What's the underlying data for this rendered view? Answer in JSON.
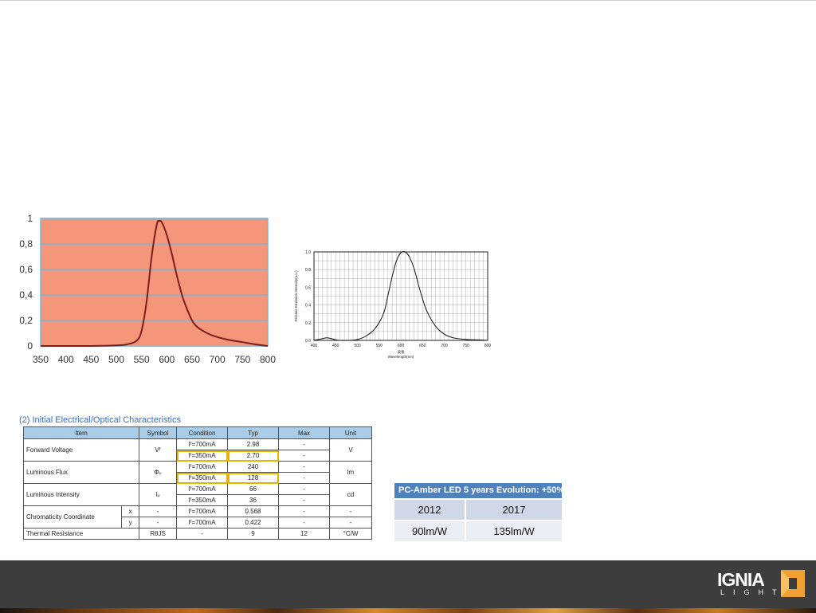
{
  "chart_data": [
    {
      "type": "line",
      "x": [
        350,
        400,
        450,
        500,
        520,
        540,
        550,
        560,
        570,
        580,
        585,
        590,
        600,
        610,
        620,
        630,
        640,
        650,
        660,
        680,
        700,
        720,
        750,
        780,
        800
      ],
      "series": [
        {
          "values": [
            0,
            0,
            0,
            0.005,
            0.012,
            0.04,
            0.12,
            0.35,
            0.7,
            0.95,
            0.98,
            0.97,
            0.87,
            0.72,
            0.55,
            0.4,
            0.29,
            0.2,
            0.15,
            0.1,
            0.07,
            0.05,
            0.03,
            0.01,
            0
          ]
        }
      ],
      "xticks": [
        "350",
        "400",
        "450",
        "500",
        "550",
        "600",
        "650",
        "700",
        "750",
        "800"
      ],
      "yticks": [
        "0",
        "0,2",
        "0,4",
        "0,6",
        "0,8",
        "1"
      ],
      "xlim": [
        350,
        800
      ],
      "ylim": [
        0,
        1
      ],
      "grid": true,
      "colors": {
        "plot_bg": "#f4967a",
        "line": "#7a1e1e",
        "grid": "#7eb6d8",
        "frame": "#7eb6d8"
      }
    },
    {
      "type": "line",
      "x": [
        400,
        410,
        420,
        430,
        440,
        450,
        460,
        480,
        500,
        520,
        540,
        560,
        570,
        580,
        590,
        600,
        610,
        620,
        630,
        640,
        650,
        660,
        680,
        700,
        720,
        750,
        780,
        800
      ],
      "series": [
        {
          "values": [
            0,
            0.01,
            0.02,
            0.03,
            0.02,
            0.005,
            0,
            0,
            0.01,
            0.05,
            0.13,
            0.3,
            0.5,
            0.72,
            0.9,
            0.99,
            1.0,
            0.94,
            0.82,
            0.64,
            0.47,
            0.33,
            0.16,
            0.07,
            0.03,
            0.01,
            0.005,
            0
          ]
        }
      ],
      "xticks": [
        "400",
        "450",
        "500",
        "550",
        "600",
        "650",
        "700",
        "750",
        "800"
      ],
      "yticks": [
        "0.0",
        "0.2",
        "0.4",
        "0.6",
        "0.8",
        "1.0"
      ],
      "xlabel": "Wavelength(nm)",
      "xlabel_cn": "波長",
      "ylabel": "Relative Emission Intensity(a.u.)",
      "xlim": [
        400,
        800
      ],
      "ylim": [
        0,
        1
      ],
      "grid": true,
      "colors": {
        "line": "#111111",
        "grid": "#9a9a9a"
      }
    }
  ],
  "spec_table": {
    "title": "(2) Initial Electrical/Optical Characteristics",
    "headers": [
      "Item",
      "Symbol",
      "Condition",
      "Typ",
      "Max",
      "Unit"
    ],
    "forward_voltage": {
      "item": "Forward Voltage",
      "symbol": "Vᶠ",
      "unit": "V",
      "rows": [
        {
          "cond": "Iᶠ=700mA",
          "typ": "2.98",
          "max": "-"
        },
        {
          "cond": "Iᶠ=350mA",
          "typ": "2.70",
          "max": "-"
        }
      ]
    },
    "luminous_flux": {
      "item": "Luminous Flux",
      "symbol": "Φᵥ",
      "unit": "lm",
      "rows": [
        {
          "cond": "Iᶠ=700mA",
          "typ": "240",
          "max": "-"
        },
        {
          "cond": "Iᶠ=350mA",
          "typ": "128",
          "max": "-"
        }
      ]
    },
    "luminous_intensity": {
      "item": "Luminous Intensity",
      "symbol": "Iᵥ",
      "unit": "cd",
      "rows": [
        {
          "cond": "Iᶠ=700mA",
          "typ": "66",
          "max": "-"
        },
        {
          "cond": "Iᶠ=350mA",
          "typ": "36",
          "max": "-"
        }
      ]
    },
    "chromaticity": {
      "item": "Chromaticity Coordinate",
      "rows": [
        {
          "axis": "x",
          "symbol": "-",
          "cond": "Iᶠ=700mA",
          "typ": "0.568",
          "max": "-",
          "unit": "-"
        },
        {
          "axis": "y",
          "symbol": "-",
          "cond": "Iᶠ=700mA",
          "typ": "0.422",
          "max": "-",
          "unit": "-"
        }
      ]
    },
    "thermal": {
      "item": "Thermal Resistance",
      "symbol": "RθJS",
      "cond": "-",
      "typ": "9",
      "max": "12",
      "unit": "°C/W"
    }
  },
  "evolution": {
    "title": "PC-Amber LED 5 years Evolution: +50%",
    "years": [
      "2012",
      "2017"
    ],
    "values": [
      "90lm/W",
      "135lm/W"
    ]
  },
  "logo": {
    "word": "IGNIA",
    "sub": "LIGHT"
  }
}
